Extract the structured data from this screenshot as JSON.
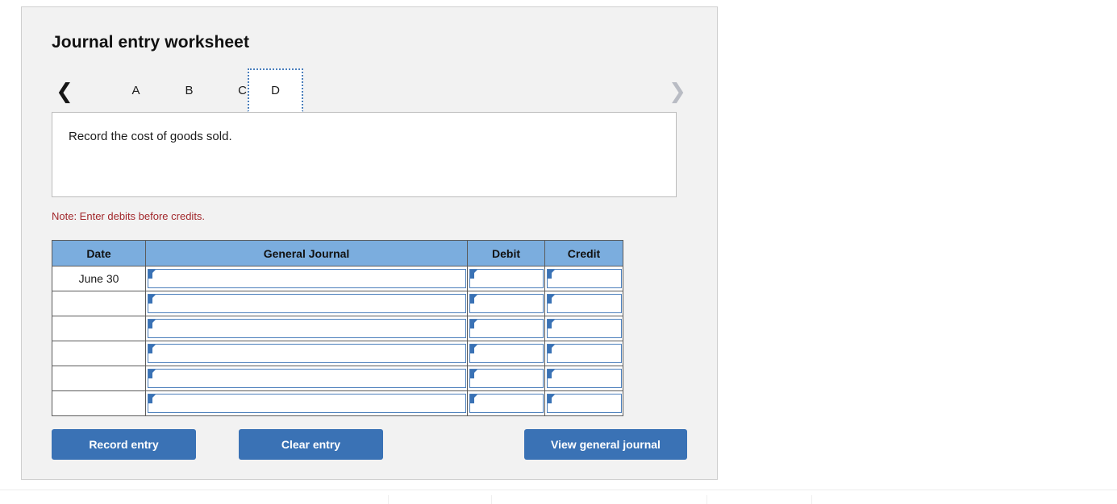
{
  "panel": {
    "title": "Journal entry worksheet"
  },
  "tabs": {
    "prev_icon": "chevron-left-icon",
    "next_icon": "chevron-right-icon",
    "items": [
      {
        "label": "A",
        "selected": false
      },
      {
        "label": "B",
        "selected": false
      },
      {
        "label": "C",
        "selected": false
      },
      {
        "label": "D",
        "selected": true
      }
    ]
  },
  "description": {
    "text": "Record the cost of goods sold."
  },
  "note": {
    "text": "Note: Enter debits before credits."
  },
  "table": {
    "headers": [
      "Date",
      "General Journal",
      "Debit",
      "Credit"
    ],
    "rows": [
      {
        "date": "June 30",
        "general_journal": "",
        "debit": "",
        "credit": ""
      },
      {
        "date": "",
        "general_journal": "",
        "debit": "",
        "credit": ""
      },
      {
        "date": "",
        "general_journal": "",
        "debit": "",
        "credit": ""
      },
      {
        "date": "",
        "general_journal": "",
        "debit": "",
        "credit": ""
      },
      {
        "date": "",
        "general_journal": "",
        "debit": "",
        "credit": ""
      },
      {
        "date": "",
        "general_journal": "",
        "debit": "",
        "credit": ""
      }
    ]
  },
  "buttons": {
    "record": "Record entry",
    "clear": "Clear entry",
    "view": "View general journal"
  },
  "colors": {
    "accent": "#3a72b5",
    "header_fill": "#7badde",
    "note": "#a2282c",
    "panel_bg": "#f2f2f2",
    "tab_focus": "#4a7ebb"
  }
}
